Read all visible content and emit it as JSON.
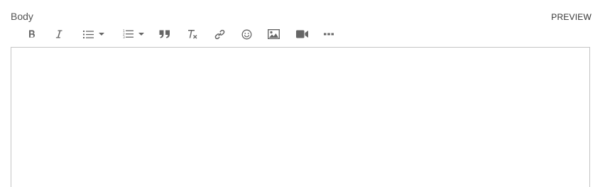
{
  "field": {
    "label": "Body",
    "preview_label": "PREVIEW"
  },
  "toolbar": {
    "icon_color": "#666666",
    "buttons": [
      "bold-icon",
      "italic-icon",
      "bulleted-list-icon",
      "numbered-list-icon",
      "blockquote-icon",
      "clear-formatting-icon",
      "link-icon",
      "emoji-icon",
      "image-icon",
      "video-icon",
      "more-icon"
    ]
  },
  "editor": {
    "content": "",
    "border_color": "#c4c4c4"
  }
}
